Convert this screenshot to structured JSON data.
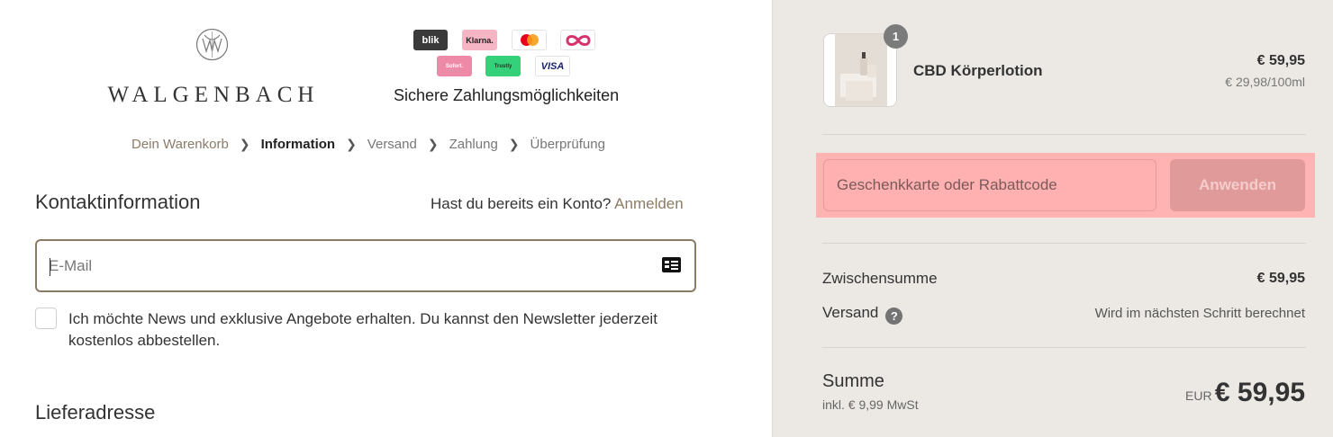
{
  "brand": {
    "name": "WALGENBACH"
  },
  "payments": {
    "methods": [
      "blik",
      "Klarna.",
      "mastercard",
      "ideal",
      "Sofort.",
      "Trustly",
      "VISA"
    ],
    "blik_label": "blik",
    "klarna_label": "Klarna.",
    "sofort_label": "Sofort.",
    "trustly_label": "Trustly",
    "visa_label": "VISA",
    "caption": "Sichere Zahlungsmöglichkeiten"
  },
  "breadcrumb": [
    {
      "label": "Dein Warenkorb"
    },
    {
      "label": "Information"
    },
    {
      "label": "Versand"
    },
    {
      "label": "Zahlung"
    },
    {
      "label": "Überprüfung"
    }
  ],
  "contact": {
    "title": "Kontaktinformation",
    "account_question": "Hast du bereits ein Konto?",
    "login_link": "Anmelden",
    "email_placeholder": "E-Mail",
    "newsletter_text": "Ich möchte News und exklusive Angebote erhalten. Du kannst den Newsletter jederzeit kostenlos abbestellen."
  },
  "delivery": {
    "title": "Lieferadresse"
  },
  "cart": {
    "quantity": "1",
    "product_name": "CBD Körperlotion",
    "product_price": "€ 59,95",
    "unit_price": "€ 29,98/100ml"
  },
  "discount": {
    "placeholder": "Geschenkkarte oder Rabattcode",
    "apply_label": "Anwenden"
  },
  "summary": {
    "subtotal_label": "Zwischensumme",
    "subtotal_value": "€ 59,95",
    "shipping_label": "Versand",
    "shipping_help": "?",
    "shipping_value": "Wird im nächsten Schritt berechnet",
    "total_label": "Summe",
    "tax_note": "inkl. € 9,99 MwSt",
    "currency": "EUR",
    "total_value": "€ 59,95"
  },
  "colors": {
    "accent": "#8b7b65",
    "sidebar_bg": "#ece9e5",
    "highlight": "#ffb3b3"
  }
}
